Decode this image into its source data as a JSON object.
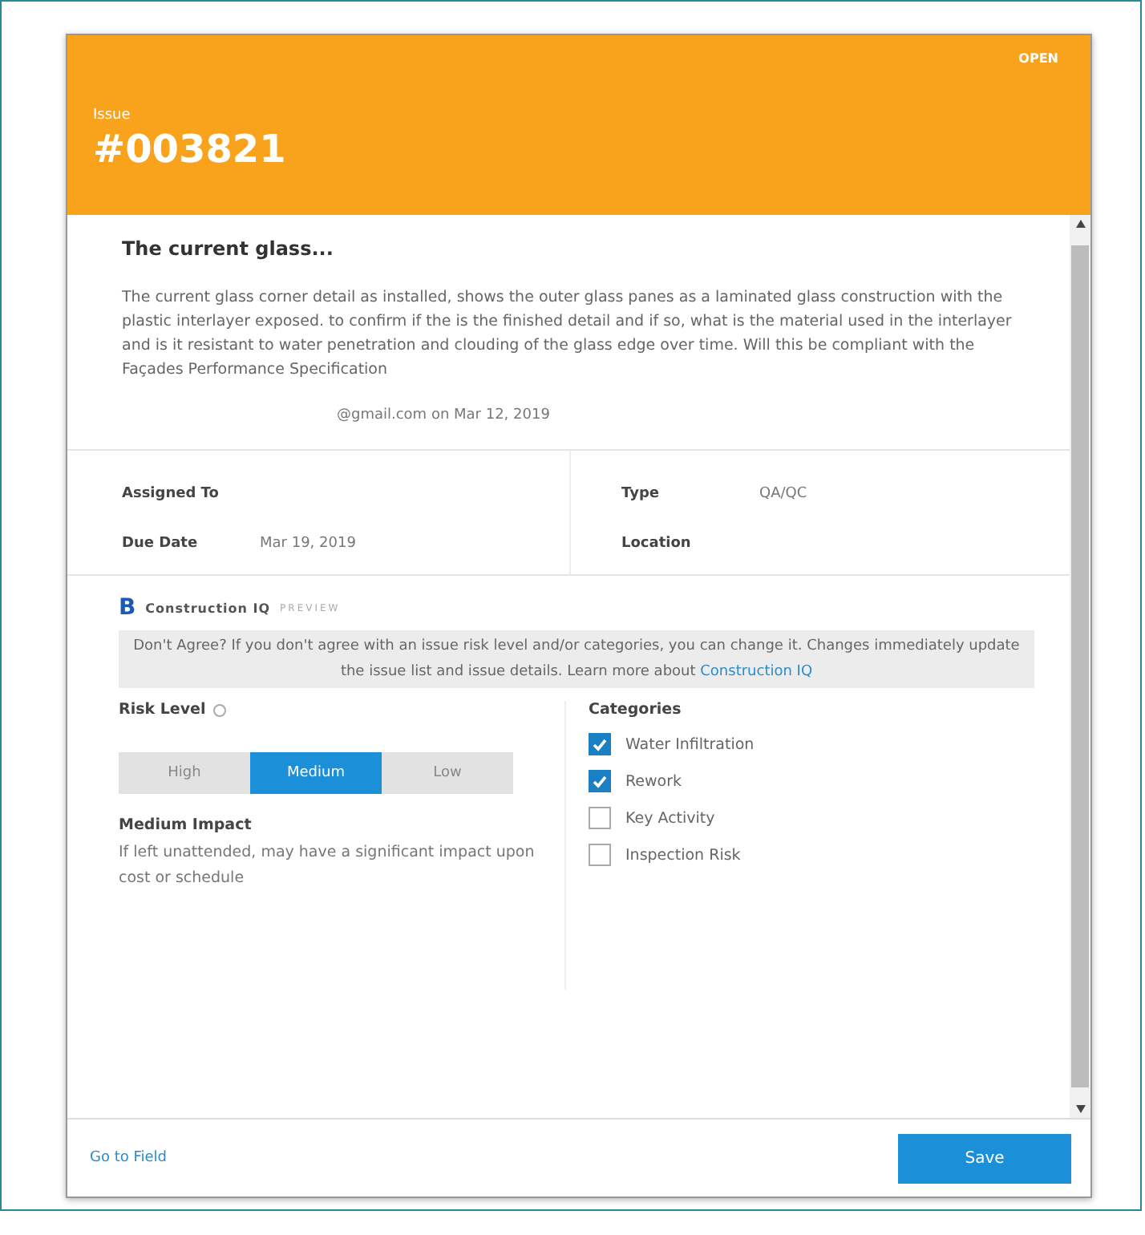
{
  "header": {
    "status": "OPEN",
    "label": "Issue",
    "number": "#003821"
  },
  "issue": {
    "title": "The current glass...",
    "description": "The current glass corner detail as installed, shows the outer glass panes as a laminated glass construction with the plastic interlayer exposed. to confirm if the is the finished detail and if so, what is the material used in the interlayer and is it resistant to water penetration and clouding of the glass edge over time. Will this be compliant with the Façades Performance Specification",
    "author": "@gmail.com on Mar 12, 2019"
  },
  "details": {
    "left": [
      {
        "label": "Assigned To"
      },
      {
        "label": "Due Date",
        "value": "Mar 19, 2019"
      }
    ],
    "right": [
      {
        "label": "Type",
        "value": "QA/QC"
      },
      {
        "label": "Location"
      }
    ]
  },
  "iq": {
    "logo": "B",
    "title": "Construction IQ",
    "badge": "PREVIEW",
    "notice": "Don't Agree? If you don't agree with an issue risk level and/or categories, you can change it. Changes immediately update the issue list and issue details. Learn more about",
    "notice_link": "Construction IQ",
    "risk_label": "Risk Level",
    "risk_options": [
      {
        "label": "High",
        "selected": false
      },
      {
        "label": "Medium",
        "selected": true
      },
      {
        "label": "Low",
        "selected": false
      }
    ],
    "impact_title": "Medium Impact",
    "impact_text": "If left unattended, may have a significant impact upon cost or schedule",
    "categories_label": "Categories",
    "categories": [
      {
        "label": "Water Infiltration",
        "checked": true
      },
      {
        "label": "Rework",
        "checked": true
      },
      {
        "label": "Key Activity",
        "checked": false
      },
      {
        "label": "Inspection Risk",
        "checked": false
      }
    ]
  },
  "footer": {
    "link": "Go to Field",
    "button": "Save"
  }
}
